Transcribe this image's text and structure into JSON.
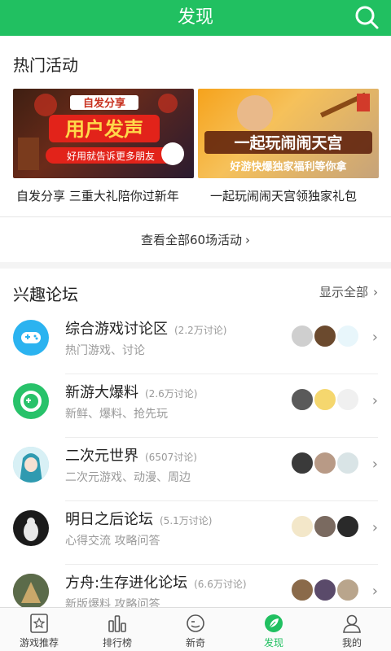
{
  "header": {
    "title": "发现"
  },
  "hot": {
    "title": "热门活动",
    "banners": [
      {
        "caption": "自发分享 三重大礼陪你过新年",
        "art_title": "用户发声",
        "art_top": "自发分享",
        "art_sub": "好用就告诉更多朋友"
      },
      {
        "caption": "一起玩闹闹天宫领独家礼包",
        "art_title": "一起玩闹闹天宫",
        "art_sub": "好游快爆独家福利等你拿"
      }
    ],
    "see_all": "查看全部60场活动"
  },
  "forum": {
    "title": "兴趣论坛",
    "show_all": "显示全部",
    "items": [
      {
        "name": "综合游戏讨论区",
        "count": "(2.2万讨论)",
        "desc": "热门游戏、讨论"
      },
      {
        "name": "新游大爆料",
        "count": "(2.6万讨论)",
        "desc": "新鲜、爆料、抢先玩"
      },
      {
        "name": "二次元世界",
        "count": "(6507讨论)",
        "desc": "二次元游戏、动漫、周边"
      },
      {
        "name": "明日之后论坛",
        "count": "(5.1万讨论)",
        "desc": "心得交流 攻略问答"
      },
      {
        "name": "方舟:生存进化论坛",
        "count": "(6.6万讨论)",
        "desc": "新版爆料 攻略问答"
      }
    ]
  },
  "tabs": [
    {
      "label": "游戏推荐",
      "icon": "star-card-icon"
    },
    {
      "label": "排行榜",
      "icon": "ranking-bars-icon"
    },
    {
      "label": "新奇",
      "icon": "face-icon"
    },
    {
      "label": "发现",
      "icon": "leaf-icon"
    },
    {
      "label": "我的",
      "icon": "person-icon"
    }
  ],
  "colors": {
    "brand": "#21c061"
  }
}
